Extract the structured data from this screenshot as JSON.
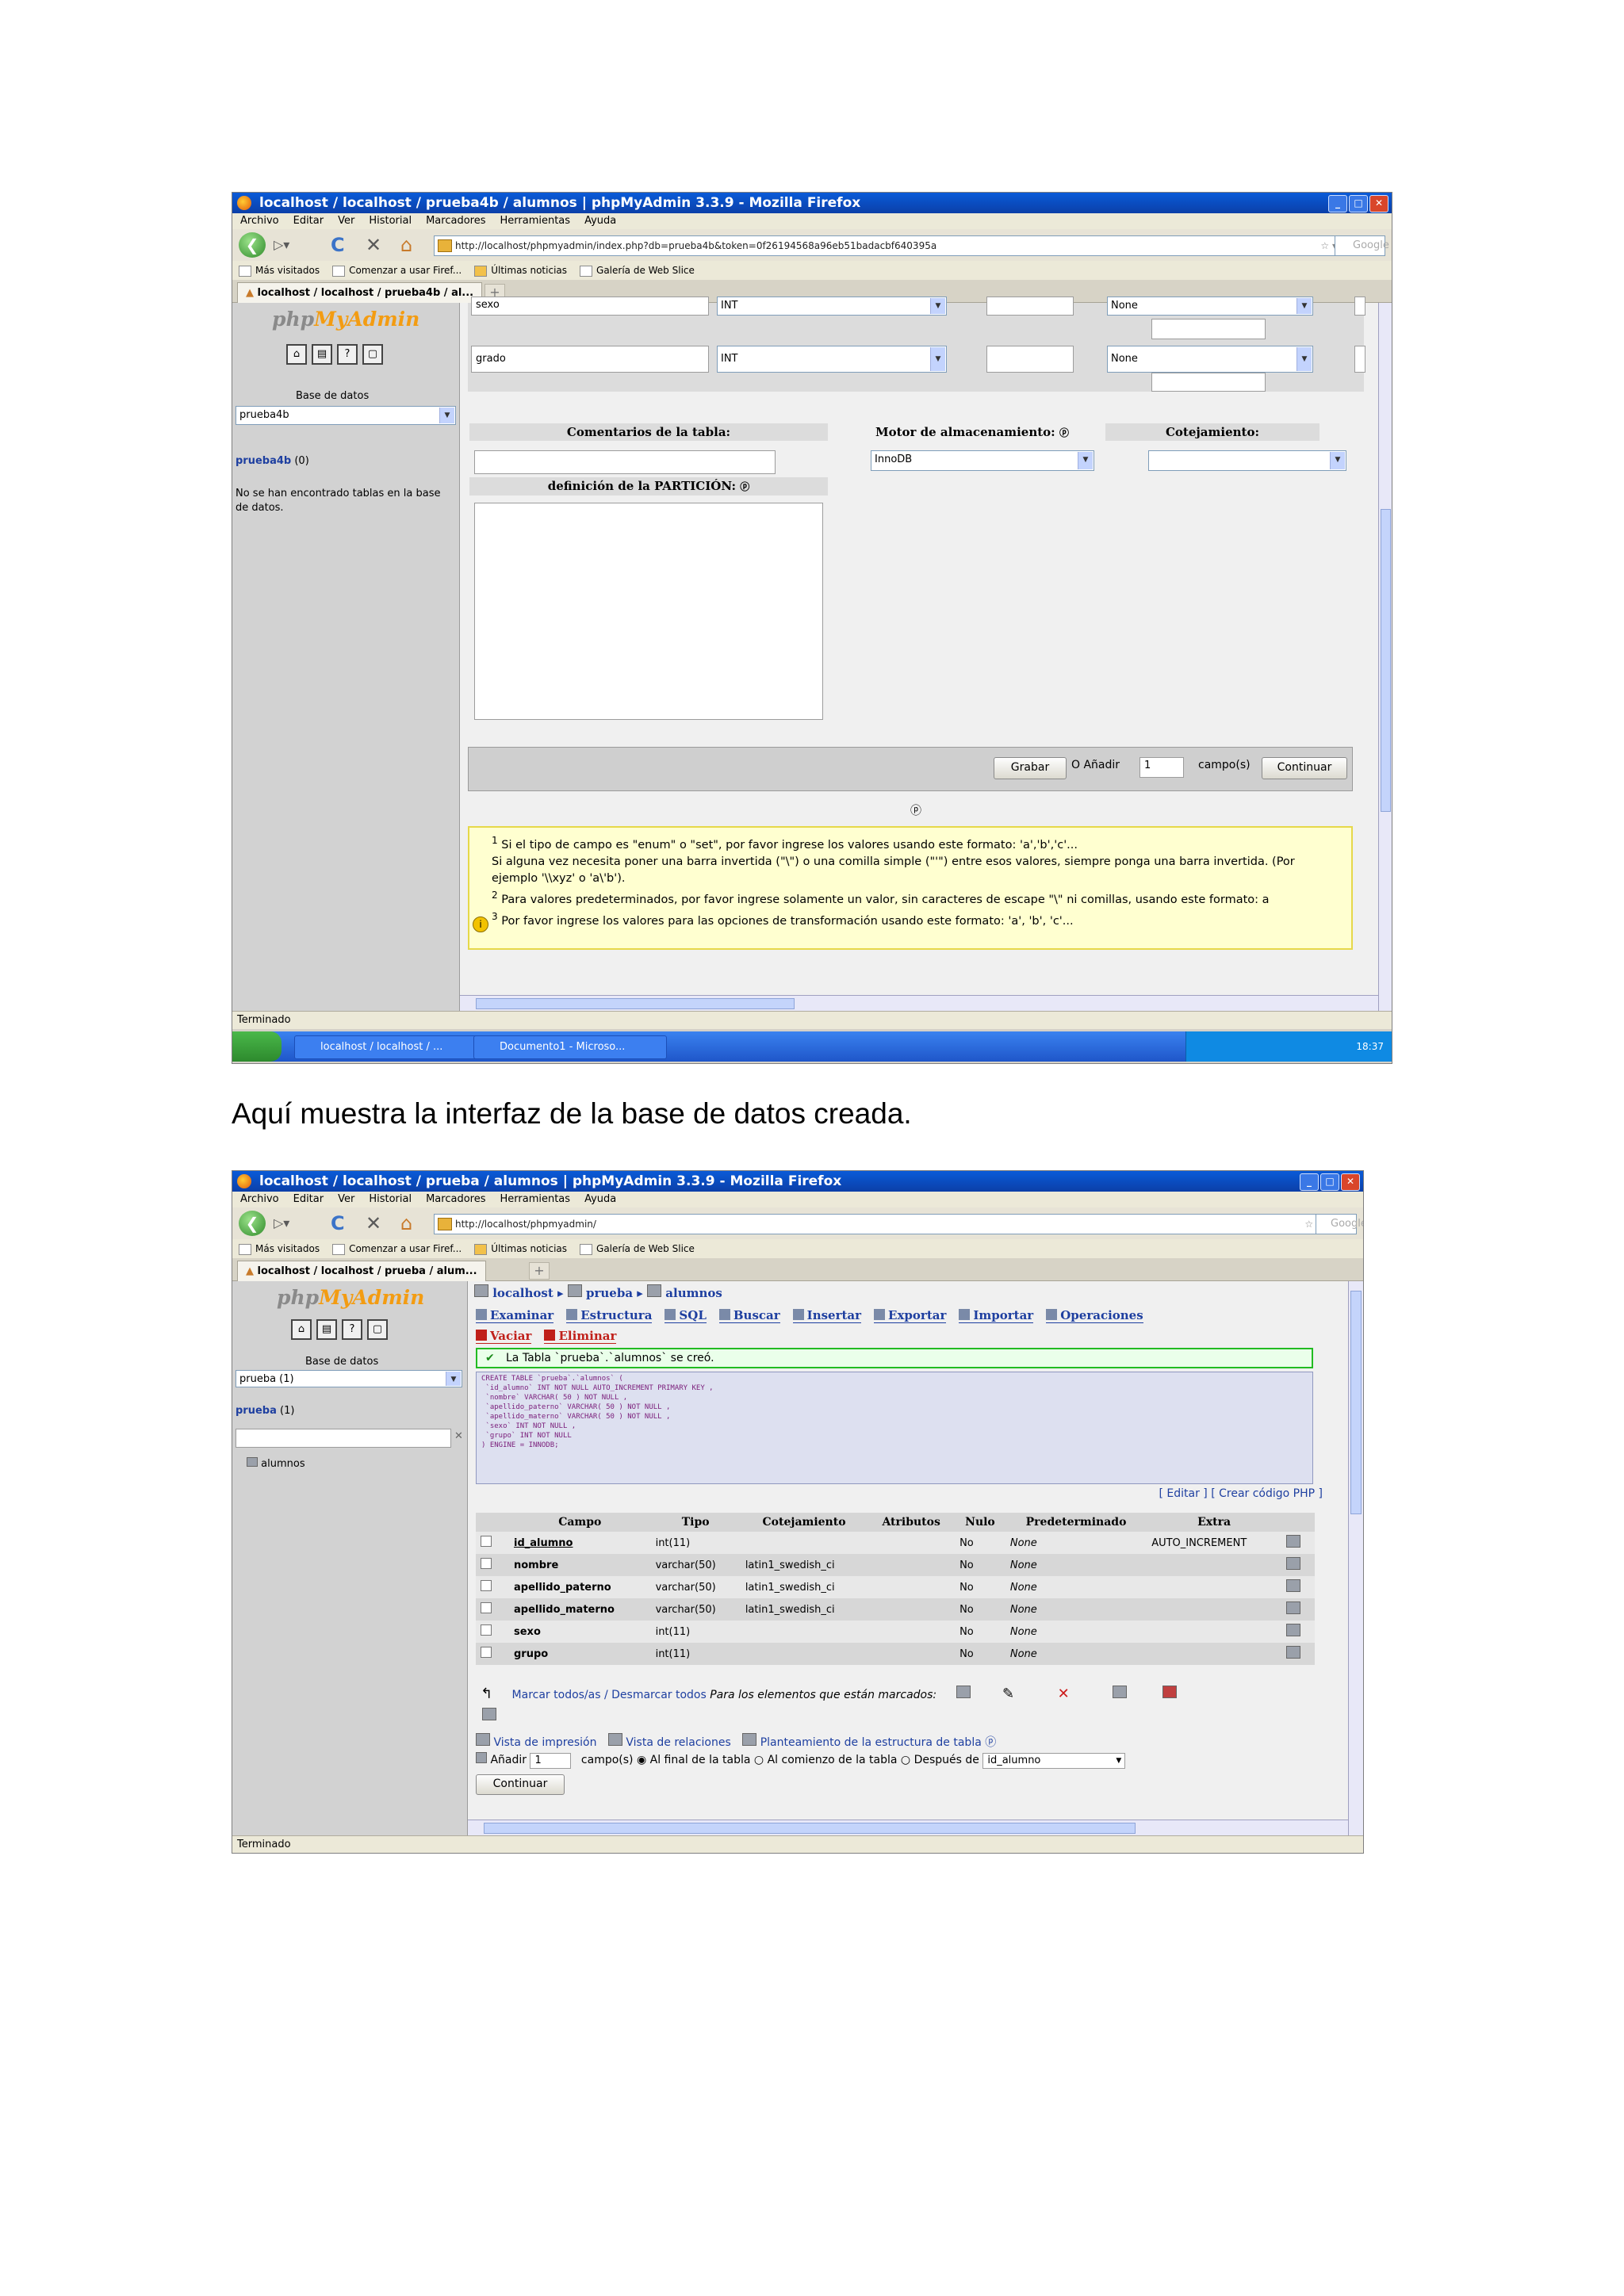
{
  "shot1": {
    "window_title": "localhost / localhost / prueba4b / alumnos | phpMyAdmin 3.3.9 - Mozilla Firefox",
    "menu": [
      "Archivo",
      "Editar",
      "Ver",
      "Historial",
      "Marcadores",
      "Herramientas",
      "Ayuda"
    ],
    "url": "http://localhost/phpmyadmin/index.php?db=prueba4b&token=0f26194568a96eb51badacbf640395a",
    "search_placeholder": "Google",
    "bookmarks": [
      "Más visitados",
      "Comenzar a usar Firef...",
      "Últimas noticias",
      "Galería de Web Slice"
    ],
    "tab": "localhost / localhost / prueba4b / al...",
    "logo_a": "php",
    "logo_b": "MyAdmin",
    "sidebar": {
      "db_label": "Base de datos",
      "db_selected": "prueba4b",
      "db_link": "prueba4b",
      "db_count": "(0)",
      "no_tables": "No se han encontrado tablas en la base de datos."
    },
    "rows": [
      {
        "name": "sexo",
        "type": "INT",
        "default": "None"
      },
      {
        "name": "grado",
        "type": "INT",
        "default": "None"
      }
    ],
    "labels": {
      "comentarios": "Comentarios de la tabla:",
      "motor": "Motor de almacenamiento:",
      "cotejamiento": "Cotejamiento:",
      "particion": "definición de la PARTICIÓN:",
      "engine_value": "InnoDB"
    },
    "actions": {
      "grabar": "Grabar",
      "o_anadir": "O Añadir",
      "campos_count": "1",
      "campos": "campo(s)",
      "continuar": "Continuar"
    },
    "notes": [
      "Si el tipo de campo es \"enum\" o \"set\", por favor ingrese los valores usando este formato: 'a','b','c'...",
      "Si alguna vez necesita poner una barra invertida (\"\\\") o una comilla simple (\"'\") entre esos valores, siempre ponga una barra invertida. (Por ejemplo '\\\\xyz' o 'a\\'b').",
      "Para valores predeterminados, por favor ingrese solamente un valor, sin caracteres de escape \"\\\" ni comillas, usando este formato: a",
      "Por favor ingrese los valores para las opciones de transformación usando este formato: 'a', 'b', 'c'..."
    ],
    "status": "Terminado",
    "taskbar": [
      "localhost / localhost / ...",
      "Documento1 - Microso..."
    ],
    "clock": "18:37"
  },
  "caption": "Aquí muestra la interfaz de la base de datos creada.",
  "shot2": {
    "window_title": "localhost / localhost / prueba / alumnos | phpMyAdmin 3.3.9 - Mozilla Firefox",
    "menu": [
      "Archivo",
      "Editar",
      "Ver",
      "Historial",
      "Marcadores",
      "Herramientas",
      "Ayuda"
    ],
    "url": "http://localhost/phpmyadmin/",
    "search_placeholder": "Google",
    "bookmarks": [
      "Más visitados",
      "Comenzar a usar Firef...",
      "Últimas noticias",
      "Galería de Web Slice"
    ],
    "tab": "localhost / localhost / prueba / alum...",
    "logo_a": "php",
    "logo_b": "MyAdmin",
    "sidebar": {
      "db_label": "Base de datos",
      "db_selected": "prueba (1)",
      "db_link": "prueba",
      "db_count": "(1)",
      "table_item": "alumnos"
    },
    "breadcrumb": [
      "localhost",
      "prueba",
      "alumnos"
    ],
    "tabs": [
      "Examinar",
      "Estructura",
      "SQL",
      "Buscar",
      "Insertar",
      "Exportar",
      "Importar",
      "Operaciones"
    ],
    "tabs_row2": [
      "Vaciar",
      "Eliminar"
    ],
    "success": "La Tabla `prueba`.`alumnos` se creó.",
    "sql": "CREATE TABLE `prueba`.`alumnos` (\n `id_alumno` INT NOT NULL AUTO_INCREMENT PRIMARY KEY ,\n `nombre` VARCHAR( 50 ) NOT NULL ,\n `apellido_paterno` VARCHAR( 50 ) NOT NULL ,\n `apellido_materno` VARCHAR( 50 ) NOT NULL ,\n `sexo` INT NOT NULL ,\n `grupo` INT NOT NULL\n) ENGINE = INNODB;",
    "sql_links": "[ Editar ] [ Crear código PHP ]",
    "columns": [
      "Campo",
      "Tipo",
      "Cotejamiento",
      "Atributos",
      "Nulo",
      "Predeterminado",
      "Extra"
    ],
    "fields": [
      {
        "campo": "id_alumno",
        "tipo": "int(11)",
        "cotejamiento": "",
        "nulo": "No",
        "pred": "None",
        "extra": "AUTO_INCREMENT"
      },
      {
        "campo": "nombre",
        "tipo": "varchar(50)",
        "cotejamiento": "latin1_swedish_ci",
        "nulo": "No",
        "pred": "None",
        "extra": ""
      },
      {
        "campo": "apellido_paterno",
        "tipo": "varchar(50)",
        "cotejamiento": "latin1_swedish_ci",
        "nulo": "No",
        "pred": "None",
        "extra": ""
      },
      {
        "campo": "apellido_materno",
        "tipo": "varchar(50)",
        "cotejamiento": "latin1_swedish_ci",
        "nulo": "No",
        "pred": "None",
        "extra": ""
      },
      {
        "campo": "sexo",
        "tipo": "int(11)",
        "cotejamiento": "",
        "nulo": "No",
        "pred": "None",
        "extra": ""
      },
      {
        "campo": "grupo",
        "tipo": "int(11)",
        "cotejamiento": "",
        "nulo": "No",
        "pred": "None",
        "extra": ""
      }
    ],
    "check_all": "Marcar todos/as / Desmarcar todos",
    "check_hint": "Para los elementos que están marcados:",
    "links": [
      "Vista de impresión",
      "Vista de relaciones",
      "Planteamiento de la estructura de tabla"
    ],
    "add_row": {
      "anadir": "Añadir",
      "count": "1",
      "campos": "campo(s)",
      "opt1": "Al final de la tabla",
      "opt2": "Al comienzo de la tabla",
      "opt3": "Después de",
      "after_value": "id_alumno",
      "continuar": "Continuar"
    },
    "status": "Terminado"
  }
}
